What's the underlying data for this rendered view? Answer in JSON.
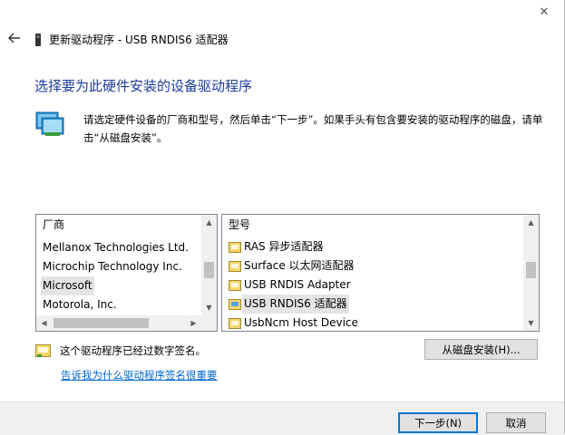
{
  "window": {
    "title": "更新驱动程序 - USB RNDIS6 适配器",
    "close_glyph": "✕",
    "back_glyph": "←"
  },
  "heading": "选择要为此硬件安装的设备驱动程序",
  "instructions": "请选定硬件设备的厂商和型号，然后单击“下一步”。如果手头有包含要安装的驱动程序的磁盘，请单击“从磁盘安装”。",
  "manufacturer_list": {
    "header": "厂商",
    "items": [
      {
        "label": "Mellanox Technologies Ltd.",
        "selected": false
      },
      {
        "label": "Microchip Technology Inc.",
        "selected": false
      },
      {
        "label": "Microsoft",
        "selected": true
      },
      {
        "label": "Motorola, Inc.",
        "selected": false
      }
    ]
  },
  "model_list": {
    "header": "型号",
    "items": [
      {
        "label": "RAS 异步适配器",
        "selected": false
      },
      {
        "label": "Surface 以太网适配器",
        "selected": false
      },
      {
        "label": "USB RNDIS Adapter",
        "selected": false
      },
      {
        "label": "USB RNDIS6 适配器",
        "selected": true
      },
      {
        "label": "UsbNcm Host Device",
        "selected": false
      }
    ]
  },
  "signature_status": "这个驱动程序已经过数字签名。",
  "signature_link": "告诉我为什么驱动程序签名很重要",
  "buttons": {
    "have_disk": "从磁盘安装(H)...",
    "next": "下一步(N)",
    "cancel": "取消"
  },
  "colors": {
    "heading": "#1e3b9a",
    "link": "#0066cc",
    "accent": "#0078d7"
  }
}
